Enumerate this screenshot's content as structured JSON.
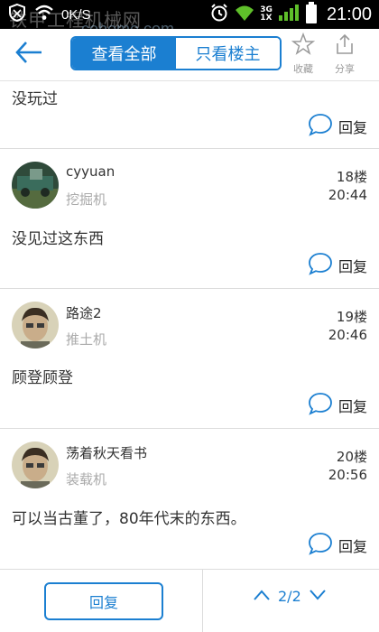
{
  "status_bar": {
    "speed": "0K/S",
    "network": [
      "3G",
      "1X"
    ],
    "time": "21:00",
    "watermark": "铁甲工程机械网",
    "watermark_url": "cehome.com"
  },
  "app_bar": {
    "tab_all": "查看全部",
    "tab_host": "只看楼主",
    "favorite_label": "收藏",
    "share_label": "分享",
    "accent": "#1b7fd1"
  },
  "posts": [
    {
      "content": "没玩过",
      "reply_label": "回复"
    },
    {
      "username": "cyyuan",
      "role": "挖掘机",
      "floor": "18楼",
      "time": "20:44",
      "content": "没见过这东西",
      "reply_label": "回复"
    },
    {
      "username": "路途2",
      "role": "推土机",
      "floor": "19楼",
      "time": "20:46",
      "content": "顾登顾登",
      "reply_label": "回复"
    },
    {
      "username": "荡着秋天看书",
      "role": "装载机",
      "floor": "20楼",
      "time": "20:56",
      "content": "可以当古董了，80年代末的东西。",
      "reply_label": "回复"
    }
  ],
  "bottom_bar": {
    "reply_label": "回复",
    "page_indicator": "2/2"
  }
}
